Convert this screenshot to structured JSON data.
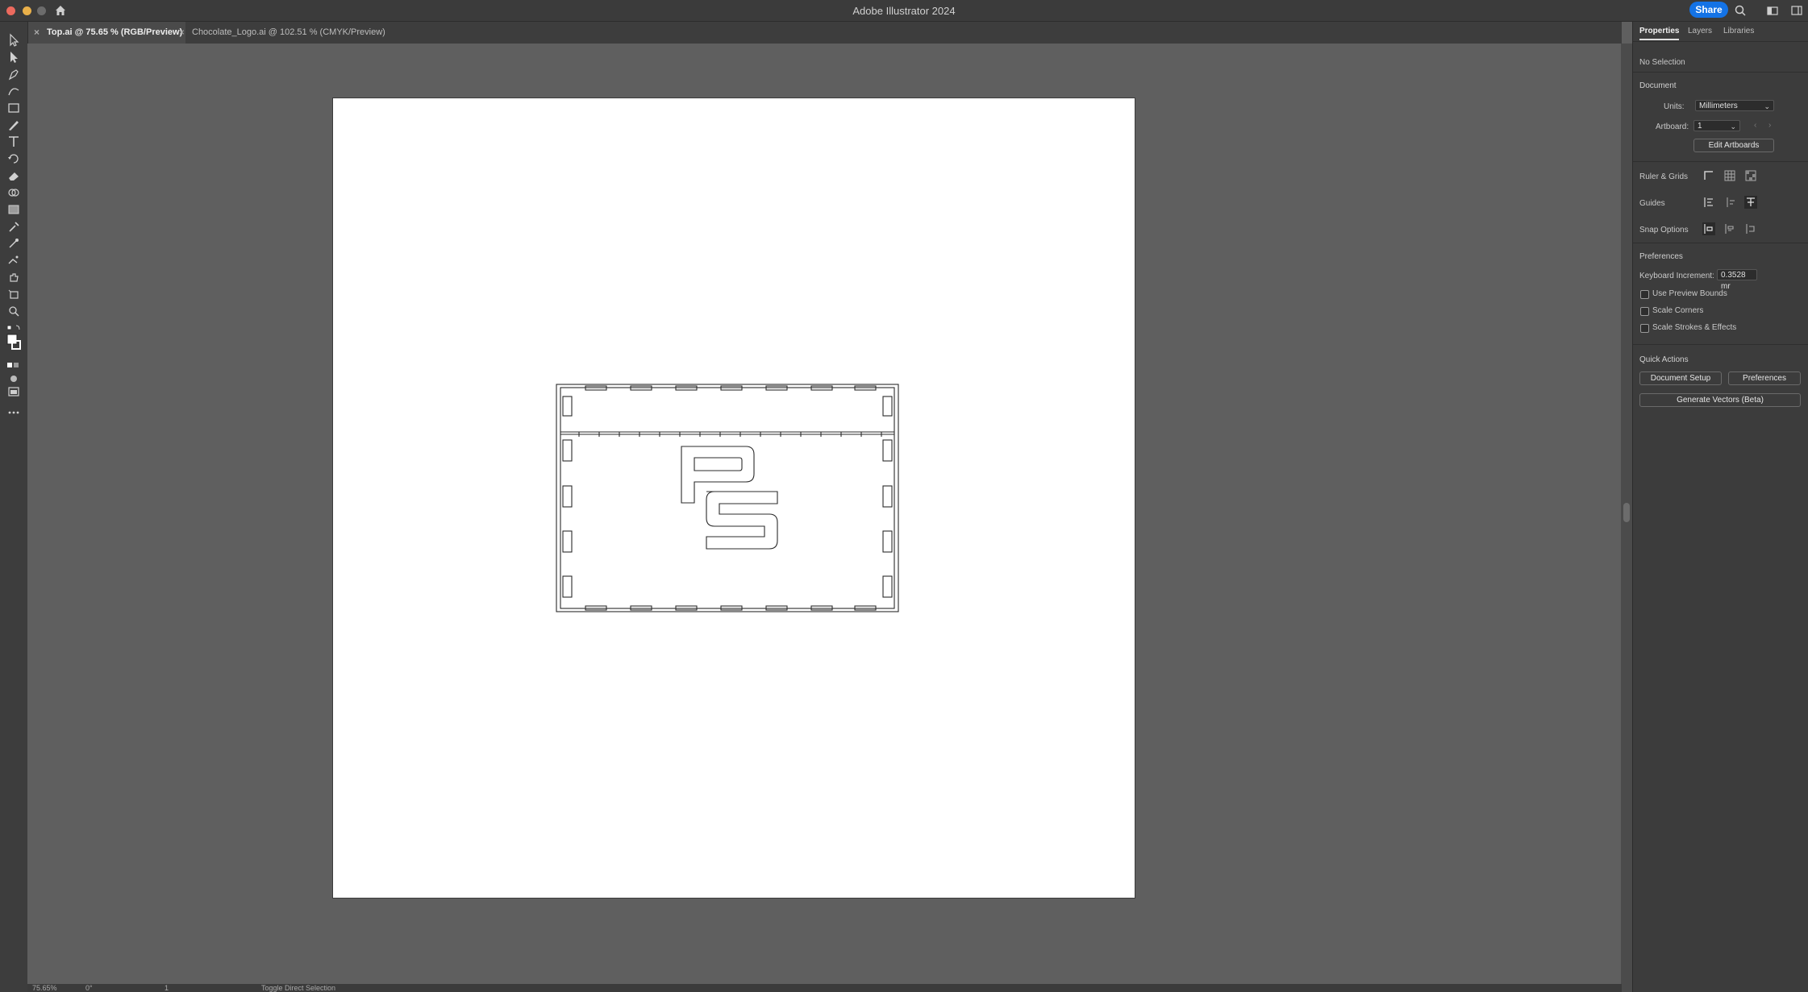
{
  "app": {
    "title": "Adobe Illustrator 2024",
    "share_label": "Share"
  },
  "tabs": [
    {
      "label": "Top.ai @ 75.65 % (RGB/Preview)",
      "active": true
    },
    {
      "label": "Chocolate_Logo.ai @ 102.51 % (CMYK/Preview)",
      "active": false
    }
  ],
  "panel": {
    "tabs": [
      "Properties",
      "Layers",
      "Libraries"
    ],
    "selection_status": "No Selection",
    "document": {
      "heading": "Document",
      "units_label": "Units:",
      "units_value": "Millimeters",
      "artboard_label": "Artboard:",
      "artboard_value": "1",
      "edit_artboards_label": "Edit Artboards"
    },
    "ruler_grids_label": "Ruler & Grids",
    "guides_label": "Guides",
    "snap_options_label": "Snap Options",
    "preferences": {
      "heading": "Preferences",
      "keyboard_increment_label": "Keyboard Increment:",
      "keyboard_increment_value": "0.3528 mr",
      "checkboxes": [
        "Use Preview Bounds",
        "Scale Corners",
        "Scale Strokes & Effects"
      ]
    },
    "quick_actions": {
      "heading": "Quick Actions",
      "document_setup": "Document Setup",
      "preferences": "Preferences",
      "generate_vectors": "Generate Vectors (Beta)"
    }
  },
  "statusbar": {
    "zoom": "75.65%",
    "rotation": "0°",
    "artboard": "1",
    "tool_hint": "Toggle Direct Selection"
  },
  "colors": {
    "accent": "#1473e6",
    "ui_dark": "#3c3c3c",
    "canvas": "#5f5f5f",
    "artboard": "#ffffff"
  }
}
